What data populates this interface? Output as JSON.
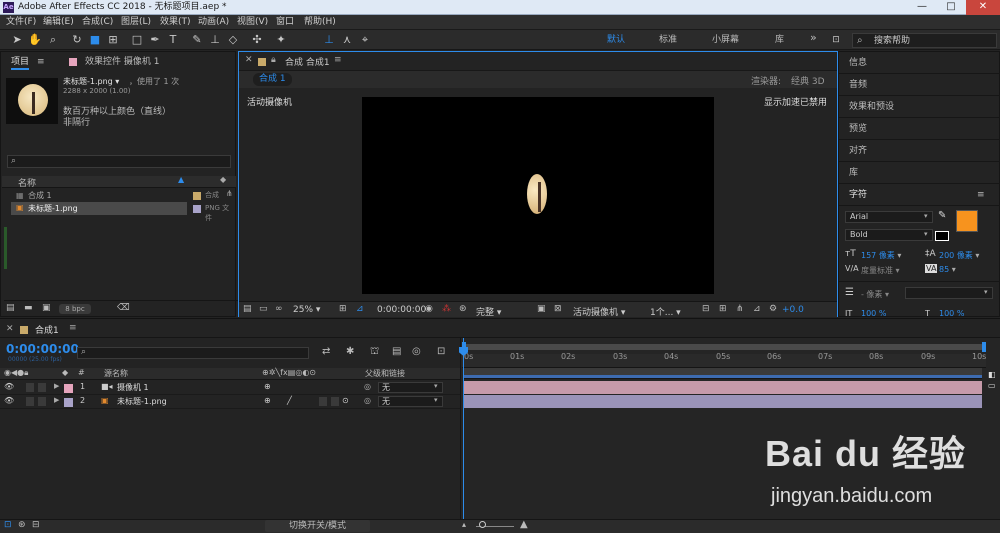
{
  "window": {
    "title": "Adobe After Effects CC 2018 - 无标题项目.aep *",
    "app_icon": "Ae",
    "minimize": "—",
    "maximize": "□",
    "close": "✕"
  },
  "menu": [
    "文件(F)",
    "编辑(E)",
    "合成(C)",
    "图层(L)",
    "效果(T)",
    "动画(A)",
    "视图(V)",
    "窗口",
    "帮助(H)"
  ],
  "workspaces": {
    "default": "默认",
    "standard": "标准",
    "small_screen": "小屏幕",
    "library": "库",
    "more": "»"
  },
  "search_help": {
    "placeholder": "搜索帮助"
  },
  "project_panel": {
    "tab_label": "项目",
    "effects_tab_label": "效果控件 摄像机 1",
    "selected_name": "未标题-1.png",
    "used_count": "，使用了 1 次",
    "dimensions": "2288 x 2000 (1.00)",
    "color_info": "数百万种以上颜色（直线）",
    "interlace": "非隔行",
    "search_placeholder": "",
    "col_name": "名称",
    "items": [
      {
        "name": "合成 1",
        "type": "合成"
      },
      {
        "name": "未标题-1.png",
        "type": "PNG 文件"
      }
    ],
    "bpc": "8 bpc"
  },
  "comp_panel": {
    "tab_label": "合成 合成1",
    "subtab": "合成 1",
    "renderer_label": "渲染器:",
    "renderer_value": "经典 3D",
    "active_camera": "活动摄像机",
    "gpu_note": "显示加速已禁用",
    "zoom": "25%",
    "timecode": "0:00:00:00",
    "quality": "完整",
    "camera": "活动摄像机",
    "views": "1个...",
    "exposure": "+0.0"
  },
  "right_panels": {
    "info": "信息",
    "audio": "音频",
    "effects": "效果和预设",
    "preview": "预览",
    "align": "对齐",
    "library": "库",
    "character": "字符",
    "font": "Arial",
    "style": "Bold",
    "size": "157 像素",
    "leading": "200 像素",
    "kerning": "度量标准",
    "tracking": "85",
    "indent_unit": "- 像素",
    "scale_h": "100 %",
    "scale_v": "100 %"
  },
  "accent_color": "#f7931e",
  "timeline": {
    "tab_label": "合成1",
    "timecode": "0:00:00:00",
    "frame_info": "00000 (25.00 fps)",
    "search_placeholder": "",
    "col_num": "#",
    "col_name": "源名称",
    "col_parent": "父级和链接",
    "layers": [
      {
        "num": "1",
        "name": "摄像机 1",
        "parent": "无"
      },
      {
        "num": "2",
        "name": "未标题-1.png",
        "parent": "无"
      }
    ],
    "ticks": [
      "0s",
      "01s",
      "02s",
      "03s",
      "04s",
      "05s",
      "06s",
      "07s",
      "08s",
      "09s",
      "10s"
    ],
    "toggle_modes": "切换开关/模式"
  },
  "watermark": {
    "brand": "Bai du 经验",
    "url": "jingyan.baidu.com"
  }
}
